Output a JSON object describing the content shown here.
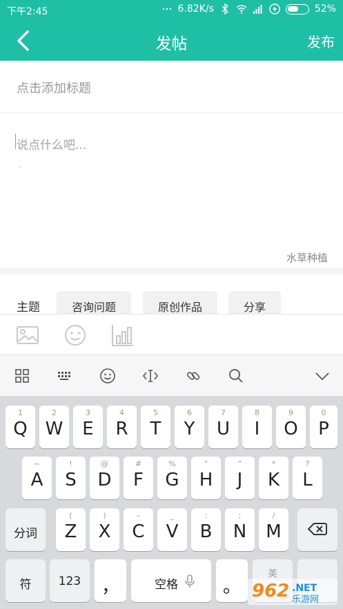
{
  "status": {
    "time": "下午2:45",
    "speed": "6.82K/s",
    "battery": "52%",
    "battery_level": 0.52
  },
  "header": {
    "title": "发帖",
    "publish": "发布"
  },
  "title_input": {
    "placeholder": "点击添加标题"
  },
  "body_input": {
    "placeholder": "说点什么吧...",
    "forum": "水草种植"
  },
  "topics": {
    "label": "主题",
    "chips": [
      "咨询问题",
      "原创作品",
      "分享"
    ]
  },
  "keyboard": {
    "row1": [
      {
        "sub": "1",
        "main": "Q"
      },
      {
        "sub": "2",
        "main": "W"
      },
      {
        "sub": "3",
        "main": "E"
      },
      {
        "sub": "4",
        "main": "R"
      },
      {
        "sub": "5",
        "main": "T"
      },
      {
        "sub": "6",
        "main": "Y"
      },
      {
        "sub": "7",
        "main": "U"
      },
      {
        "sub": "8",
        "main": "I"
      },
      {
        "sub": "9",
        "main": "O"
      },
      {
        "sub": "0",
        "main": "P"
      }
    ],
    "row2": [
      {
        "sub": "~",
        "main": "A"
      },
      {
        "sub": "!",
        "main": "S"
      },
      {
        "sub": "@",
        "main": "D"
      },
      {
        "sub": "#",
        "main": "F"
      },
      {
        "sub": "%",
        "main": "G"
      },
      {
        "sub": "“",
        "main": "H"
      },
      {
        "sub": "”",
        "main": "J"
      },
      {
        "sub": "*",
        "main": "K"
      },
      {
        "sub": "?",
        "main": "L"
      }
    ],
    "row3": [
      {
        "sub": "(",
        "main": "Z"
      },
      {
        "sub": ")",
        "main": "X"
      },
      {
        "sub": "–",
        "main": "C"
      },
      {
        "sub": "_",
        "main": "V"
      },
      {
        "sub": ":",
        "main": "B"
      },
      {
        "sub": ";",
        "main": "N"
      },
      {
        "sub": "/",
        "main": "M"
      }
    ],
    "fenci": "分词",
    "symbol": "符",
    "num": "123",
    "comma": "，",
    "space": "空格",
    "period": "。",
    "lang_sub": "英"
  },
  "watermark": {
    "text": "962",
    "suffix": ".NET",
    "sub": "乐游网"
  }
}
